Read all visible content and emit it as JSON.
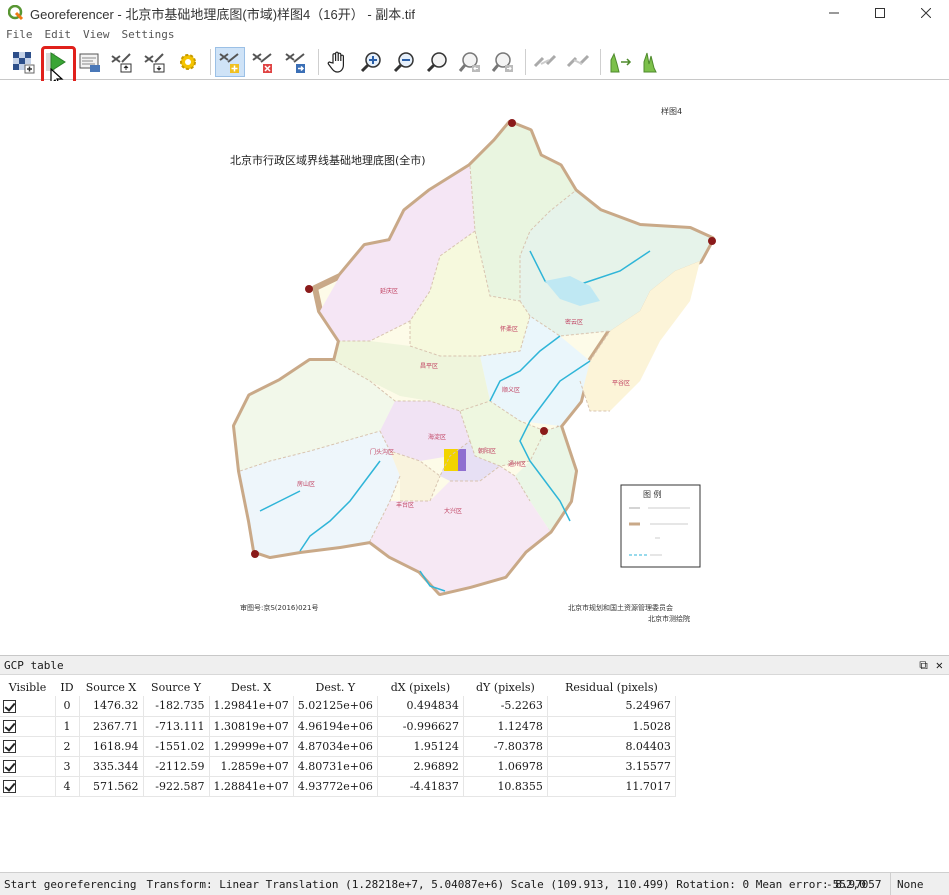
{
  "window": {
    "title": "Georeferencer - 北京市基础地理底图(市域)样图4（16开） - 副本.tif"
  },
  "menu": [
    "File",
    "Edit",
    "View",
    "Settings"
  ],
  "toolbar": {
    "buttons": [
      "open-raster-icon",
      "start-georeferencing-icon",
      "generate-gdal-script-icon",
      "load-gcp-points-icon",
      "save-gcp-points-icon",
      "transformation-settings-icon",
      "add-point-icon",
      "delete-point-icon",
      "move-gcp-point-icon",
      "pan-icon",
      "zoom-in-icon",
      "zoom-out-icon",
      "zoom-to-layer-icon",
      "zoom-last-icon",
      "zoom-next-icon",
      "link-georeferencer-to-qgis-icon",
      "link-qgis-to-georeferencer-icon",
      "full-histogram-stretch-icon",
      "local-histogram-stretch-icon"
    ]
  },
  "map": {
    "title": "北京市行政区域界线基础地理底图(全市)",
    "top_right_mark": "样图4",
    "bottom_left_note": "审图号:京S(2016)021号",
    "bottom_right_note1": "北京市规划和国土资源管理委员会",
    "bottom_right_note2": "北京市测绘院",
    "legend_title": "图  例",
    "districts": [
      "延庆区",
      "怀柔区",
      "密云区",
      "昌平区",
      "顺义区",
      "平谷区",
      "门头沟区",
      "海淀区",
      "朝阳区",
      "通州区",
      "房山区",
      "丰台区",
      "大兴区"
    ]
  },
  "gcp_panel": {
    "title": "GCP table",
    "headers": [
      "Visible",
      "ID",
      "Source X",
      "Source Y",
      "Dest. X",
      "Dest. Y",
      "dX (pixels)",
      "dY (pixels)",
      "Residual (pixels)"
    ],
    "rows": [
      [
        "0",
        "1476.32",
        "-182.735",
        "1.29841e+07",
        "5.02125e+06",
        "0.494834",
        "-5.2263",
        "5.24967"
      ],
      [
        "1",
        "2367.71",
        "-713.111",
        "1.30819e+07",
        "4.96194e+06",
        "-0.996627",
        "1.12478",
        "1.5028"
      ],
      [
        "2",
        "1618.94",
        "-1551.02",
        "1.29999e+07",
        "4.87034e+06",
        "1.95124",
        "-7.80378",
        "8.04403"
      ],
      [
        "3",
        "335.344",
        "-2112.59",
        "1.2859e+07",
        "4.80731e+06",
        "2.96892",
        "1.06978",
        "3.15577"
      ],
      [
        "4",
        "571.562",
        "-922.587",
        "1.28841e+07",
        "4.93772e+06",
        "-4.41837",
        "10.8355",
        "11.7017"
      ]
    ]
  },
  "status": {
    "message": "Start georeferencing",
    "transform": "Transform: Linear Translation (1.28218e+7, 5.04087e+6) Scale (109.913, 110.499) Rotation: 0 Mean error: 8.97057",
    "coords": "-552,0",
    "crs": "None"
  },
  "colors": {
    "highlight": "#e0201b",
    "boundary": "#b99a7a",
    "river": "#2fb5d8"
  }
}
